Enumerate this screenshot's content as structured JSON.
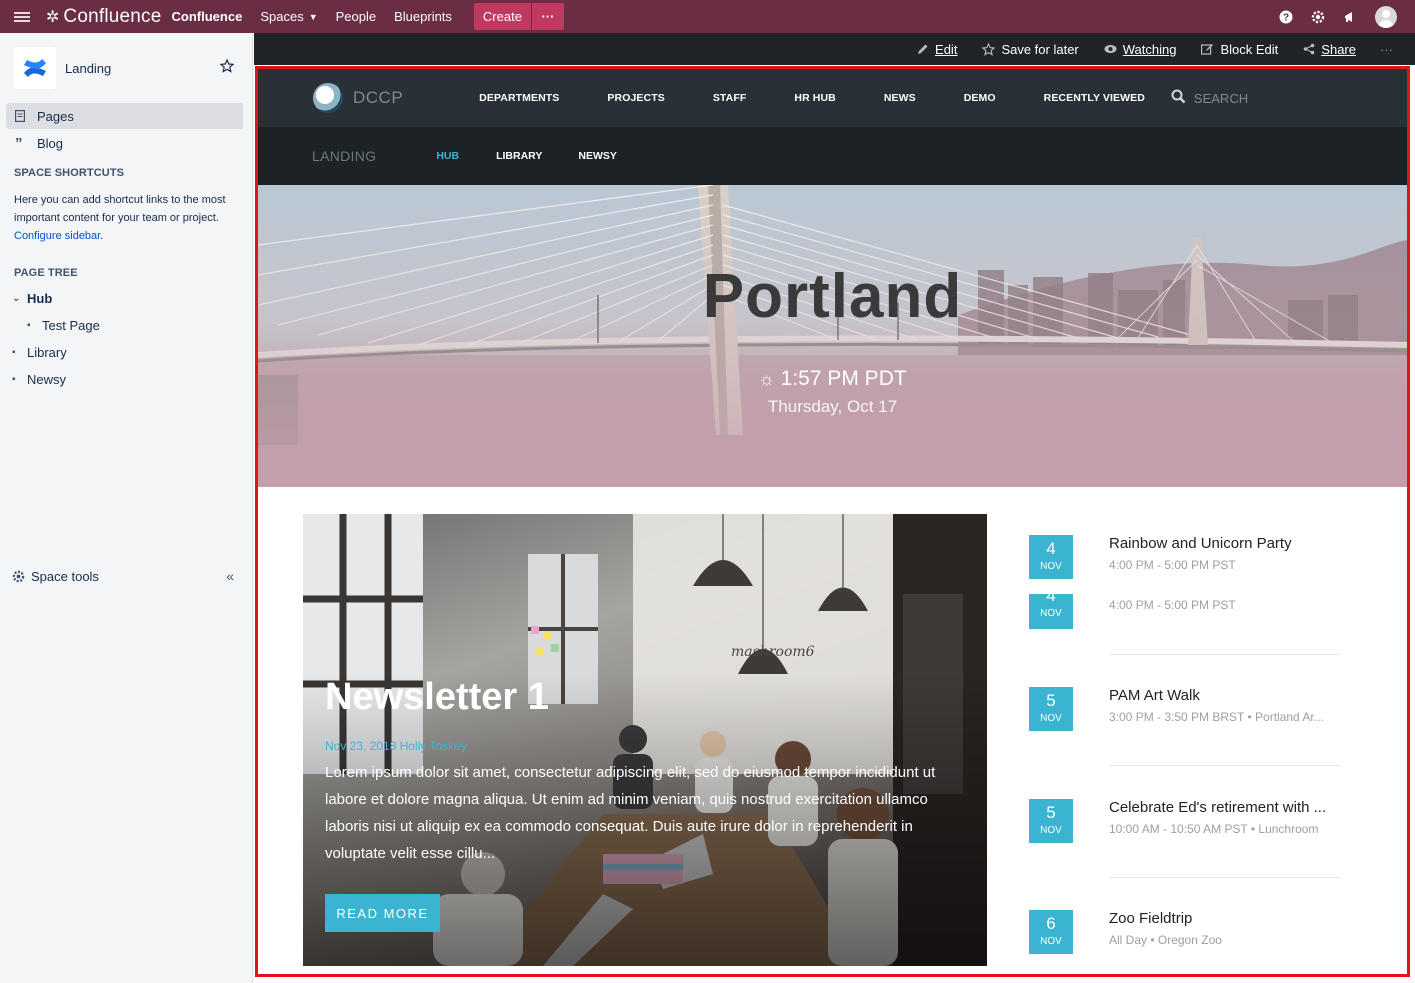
{
  "topnav": {
    "logo_text": "Confluence",
    "site_name": "Confluence",
    "items": [
      "Spaces",
      "People",
      "Blueprints"
    ],
    "create_label": "Create",
    "more_label": "···",
    "colors": {
      "bar": "#6b2d43",
      "create": "#c0395e"
    }
  },
  "sidebar": {
    "space_name": "Landing",
    "links": [
      {
        "label": "Pages",
        "icon": "page-icon"
      },
      {
        "label": "Blog",
        "icon": "quote-icon"
      }
    ],
    "shortcuts_heading": "SPACE SHORTCUTS",
    "shortcuts_text": "Here you can add shortcut links to the most important content for your team or project.",
    "configure_link": "Configure sidebar",
    "page_tree_heading": "PAGE TREE",
    "tree": [
      {
        "label": "Hub"
      },
      {
        "label": "Test Page"
      },
      {
        "label": "Library"
      },
      {
        "label": "Newsy"
      }
    ],
    "space_tools": "Space tools"
  },
  "pagebar": {
    "edit": "Edit",
    "save_for_later": "Save for later",
    "watching": "Watching",
    "block_edit": "Block Edit",
    "share": "Share",
    "more": "···"
  },
  "dccp": {
    "brand": "DCCP",
    "menu": [
      "DEPARTMENTS",
      "PROJECTS",
      "STAFF",
      "HR HUB",
      "NEWS",
      "DEMO",
      "RECENTLY VIEWED"
    ],
    "search": "SEARCH",
    "section_title": "LANDING",
    "subnav": [
      "HUB",
      "LIBRARY",
      "NEWSY"
    ],
    "accent": "#3ab4d1"
  },
  "hero": {
    "city": "Portland",
    "time": "1:57 PM PDT",
    "date": "Thursday, Oct 17"
  },
  "news": {
    "title": "Newsletter 1",
    "meta": "Nov 23, 2018  Holly Toskey",
    "body": "Lorem ipsum dolor sit amet, consectetur adipiscing elit, sed do eiusmod tempor incididunt ut labore et dolore magna aliqua. Ut enim ad minim veniam, quis nostrud exercitation ullamco laboris nisi ut aliquip ex ea commodo consequat. Duis aute irure dolor in reprehenderit in voluptate velit esse cillu...",
    "button": "READ MORE",
    "sign_text": "mashroom6"
  },
  "events": [
    {
      "day": "4",
      "month": "NOV",
      "title": "Rainbow and Unicorn Party",
      "sub": "4:00 PM - 5:00 PM PST"
    },
    {
      "day": "4",
      "month": "NOV",
      "title": "",
      "sub": "4:00 PM - 5:00 PM PST"
    },
    {
      "day": "5",
      "month": "NOV",
      "title": "PAM Art Walk",
      "sub": "3:00 PM - 3:50 PM BRST  •  Portland Ar..."
    },
    {
      "day": "5",
      "month": "NOV",
      "title": "Celebrate Ed's retirement with ...",
      "sub": "10:00 AM - 10:50 AM PST  •  Lunchroom"
    },
    {
      "day": "6",
      "month": "NOV",
      "title": "Zoo Fieldtrip",
      "sub": "All Day  •  Oregon Zoo"
    }
  ]
}
